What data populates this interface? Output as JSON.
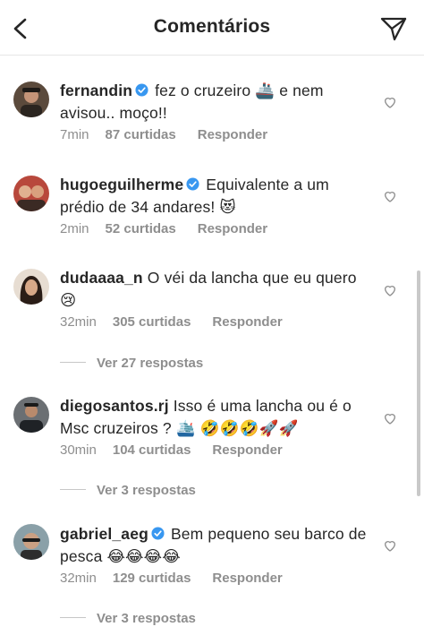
{
  "header": {
    "title": "Comentários"
  },
  "comments": [
    {
      "username": "fernandin",
      "verified": true,
      "text": "fez o cruzeiro 🚢 e nem avisou.. moço!!",
      "time": "7min",
      "likes": "87 curtidas",
      "reply": "Responder"
    },
    {
      "username": "hugoeguilherme",
      "verified": true,
      "text": "Equivalente a um prédio de 34 andares! 😻",
      "time": "2min",
      "likes": "52 curtidas",
      "reply": "Responder"
    },
    {
      "username": "dudaaaa_n",
      "verified": false,
      "text": "O véi da lancha que eu quero 😢",
      "time": "32min",
      "likes": "305 curtidas",
      "reply": "Responder",
      "view_replies": "Ver 27 respostas"
    },
    {
      "username": "diegosantos.rj",
      "verified": false,
      "text": "Isso é uma lancha ou é o Msc cruzeiros ? 🛳️ 🤣🤣🤣🚀🚀",
      "time": "30min",
      "likes": "104 curtidas",
      "reply": "Responder",
      "view_replies": "Ver 3 respostas"
    },
    {
      "username": "gabriel_aeg",
      "verified": true,
      "text": "Bem pequeno seu barco de pesca 😂😂😂😂",
      "time": "32min",
      "likes": "129 curtidas",
      "reply": "Responder",
      "view_replies": "Ver 3 respostas"
    }
  ],
  "colors": {
    "text": "#262626",
    "secondary": "#8e8e8e",
    "verified": "#3897f0",
    "divider": "#e6e6e6"
  }
}
